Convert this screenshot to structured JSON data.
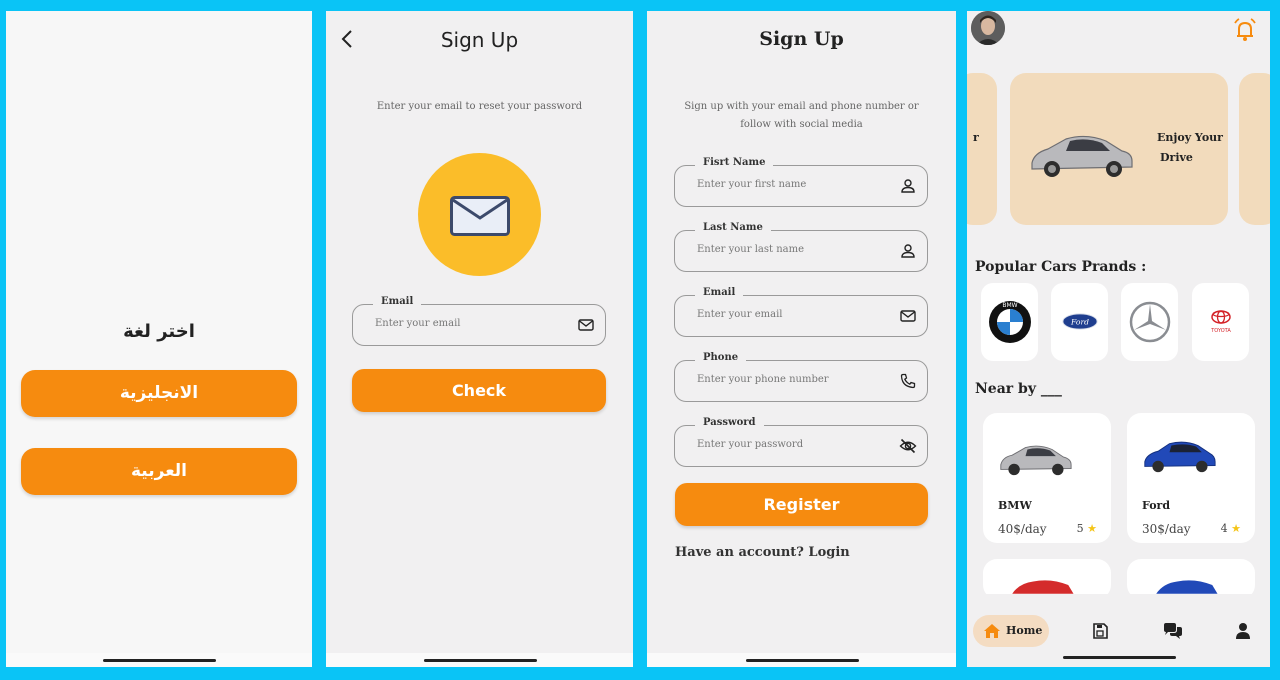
{
  "screen1": {
    "title": "اختر لغة",
    "english_label": "الانجليزية",
    "arabic_label": "العربية"
  },
  "screen2": {
    "title": "Sign Up",
    "subtitle": "Enter your email to reset your password",
    "email_label": "Email",
    "email_placeholder": "Enter your email",
    "check_label": "Check"
  },
  "screen3": {
    "title": "Sign Up",
    "subtitle_line1": "Sign up with your email and phone number or",
    "subtitle_line2": "follow with social media",
    "fields": [
      {
        "label": "Fisrt Name",
        "placeholder": "Enter your first name",
        "icon": "person-icon"
      },
      {
        "label": "Last Name",
        "placeholder": "Enter your last name",
        "icon": "person-icon"
      },
      {
        "label": "Email",
        "placeholder": "Enter your email",
        "icon": "mail-icon"
      },
      {
        "label": "Phone",
        "placeholder": "Enter your phone number",
        "icon": "phone-icon"
      },
      {
        "label": "Password",
        "placeholder": "Enter your password",
        "icon": "eye-off-icon"
      }
    ],
    "register_label": "Register",
    "login_text": "Have an account? Login"
  },
  "screen4": {
    "banner_left_text": "r",
    "banner_line1": "Enjoy Your",
    "banner_line2": "Drive",
    "brands_title": "Popular Cars Prands :",
    "brands": [
      "BMW",
      "Ford",
      "Mercedes",
      "TOYOTA"
    ],
    "nearby_title": "Near by ___",
    "cars": [
      {
        "name": "BMW",
        "price": "40$/day",
        "rating": "5"
      },
      {
        "name": "Ford",
        "price": "30$/day",
        "rating": "4"
      }
    ],
    "nav_home": "Home"
  },
  "colors": {
    "background": "#0ac4f6",
    "accent": "#f68b0f",
    "mail_circle": "#fbbd29",
    "banner": "#f2dbbc"
  }
}
